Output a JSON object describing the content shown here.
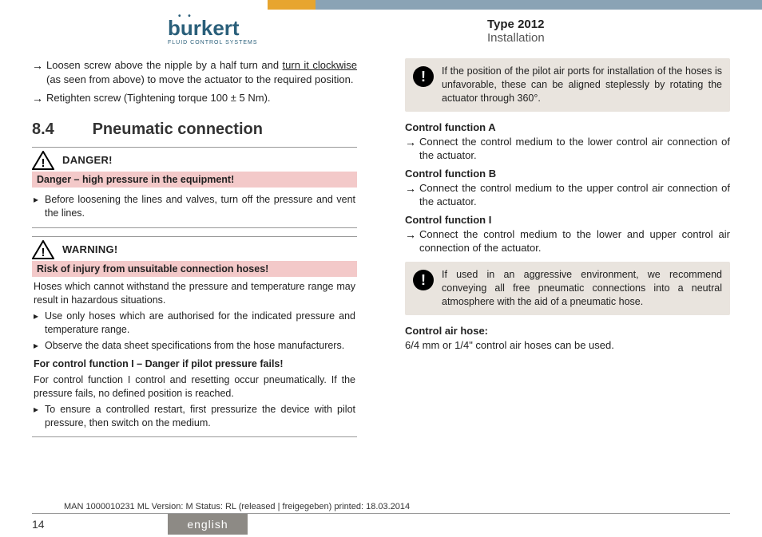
{
  "header": {
    "logo_text": "burkert",
    "logo_sub": "FLUID CONTROL SYSTEMS",
    "type_label": "Type 2012",
    "section_label": "Installation"
  },
  "left_col": {
    "intro_items": [
      {
        "pre": "Loosen screw above the nipple by a half turn and ",
        "u": "turn it clockwise",
        "post": " (as seen from above) to move the actuator to the required position."
      },
      {
        "pre": "Retighten screw (Tightening torque 100 ± 5 Nm).",
        "u": "",
        "post": ""
      }
    ],
    "section_number": "8.4",
    "section_title": "Pneumatic connection",
    "danger": {
      "label": "DANGER!",
      "subhead": "Danger – high pressure in the equipment!",
      "bullets": [
        "Before loosening the lines and valves, turn off the pressure and vent the lines."
      ]
    },
    "warning": {
      "label": "WARNING!",
      "subhead": "Risk of injury from unsuitable connection hoses!",
      "lead": "Hoses which cannot withstand the pressure and temperature range may result in hazardous situations.",
      "bullets": [
        "Use only hoses which are authorised for the indicated pressure and temperature range.",
        "Observe the data sheet specifications from the hose manufacturers."
      ],
      "cf_head": "For control function I – Danger if pilot pressure fails!",
      "cf_lead": "For control function I control and resetting occur pneumatically. If the pressure fails, no defined position is reached.",
      "cf_bullets": [
        "To ensure a controlled restart, first pressurize the device with pilot pressure, then switch on the medium."
      ]
    }
  },
  "right_col": {
    "note1": "If the position of the pilot air ports for installation of the hoses is unfavorable, these can be aligned steplessly by rotating the actuator through 360°.",
    "cfA_head": "Control function A",
    "cfA_text": "Connect the control medium to the lower control air connection of the actuator.",
    "cfB_head": "Control function B",
    "cfB_text": "Connect the control medium to the upper control air connection of the actuator.",
    "cfI_head": "Control function I",
    "cfI_text": "Connect the control medium to the lower and upper control air connection of the actuator.",
    "note2": "If used in an aggressive environment, we recommend conveying all free pneumatic connections into a neutral atmosphere with the aid of a pneumatic hose.",
    "hose_head": "Control air hose:",
    "hose_text": "6/4 mm or 1/4\" control air hoses can be used."
  },
  "footer": {
    "meta": "MAN 1000010231 ML Version: M Status: RL (released | freigegeben) printed: 18.03.2014",
    "page": "14",
    "lang": "english"
  }
}
